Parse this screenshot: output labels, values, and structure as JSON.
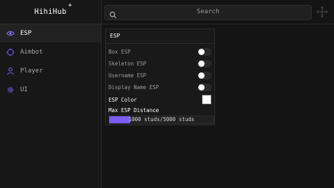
{
  "app": {
    "title": "HihiHub",
    "title_mark": "+"
  },
  "search": {
    "placeholder": "Search"
  },
  "sidebar": {
    "items": [
      {
        "label": "ESP",
        "icon": "eye-icon",
        "active": true
      },
      {
        "label": "Aimbot",
        "icon": "crosshair-icon",
        "active": false
      },
      {
        "label": "Player",
        "icon": "user-icon",
        "active": false
      },
      {
        "label": "UI",
        "icon": "gear-icon",
        "active": false
      }
    ]
  },
  "panel": {
    "title": "ESP",
    "toggles": [
      {
        "label": "Box ESP",
        "on": false
      },
      {
        "label": "Skeleton ESP",
        "on": false
      },
      {
        "label": "Username ESP",
        "on": false
      },
      {
        "label": "Display Name ESP",
        "on": false
      }
    ],
    "color": {
      "label": "ESP Color",
      "value": "#ffffff"
    },
    "distance": {
      "label": "Max ESP Distance",
      "value_text": "1000 studs/5000 studs",
      "value": 1000,
      "max": 5000
    }
  },
  "colors": {
    "accent": "#7b5cf0",
    "background": "#141414",
    "sidebar": "#171717"
  }
}
